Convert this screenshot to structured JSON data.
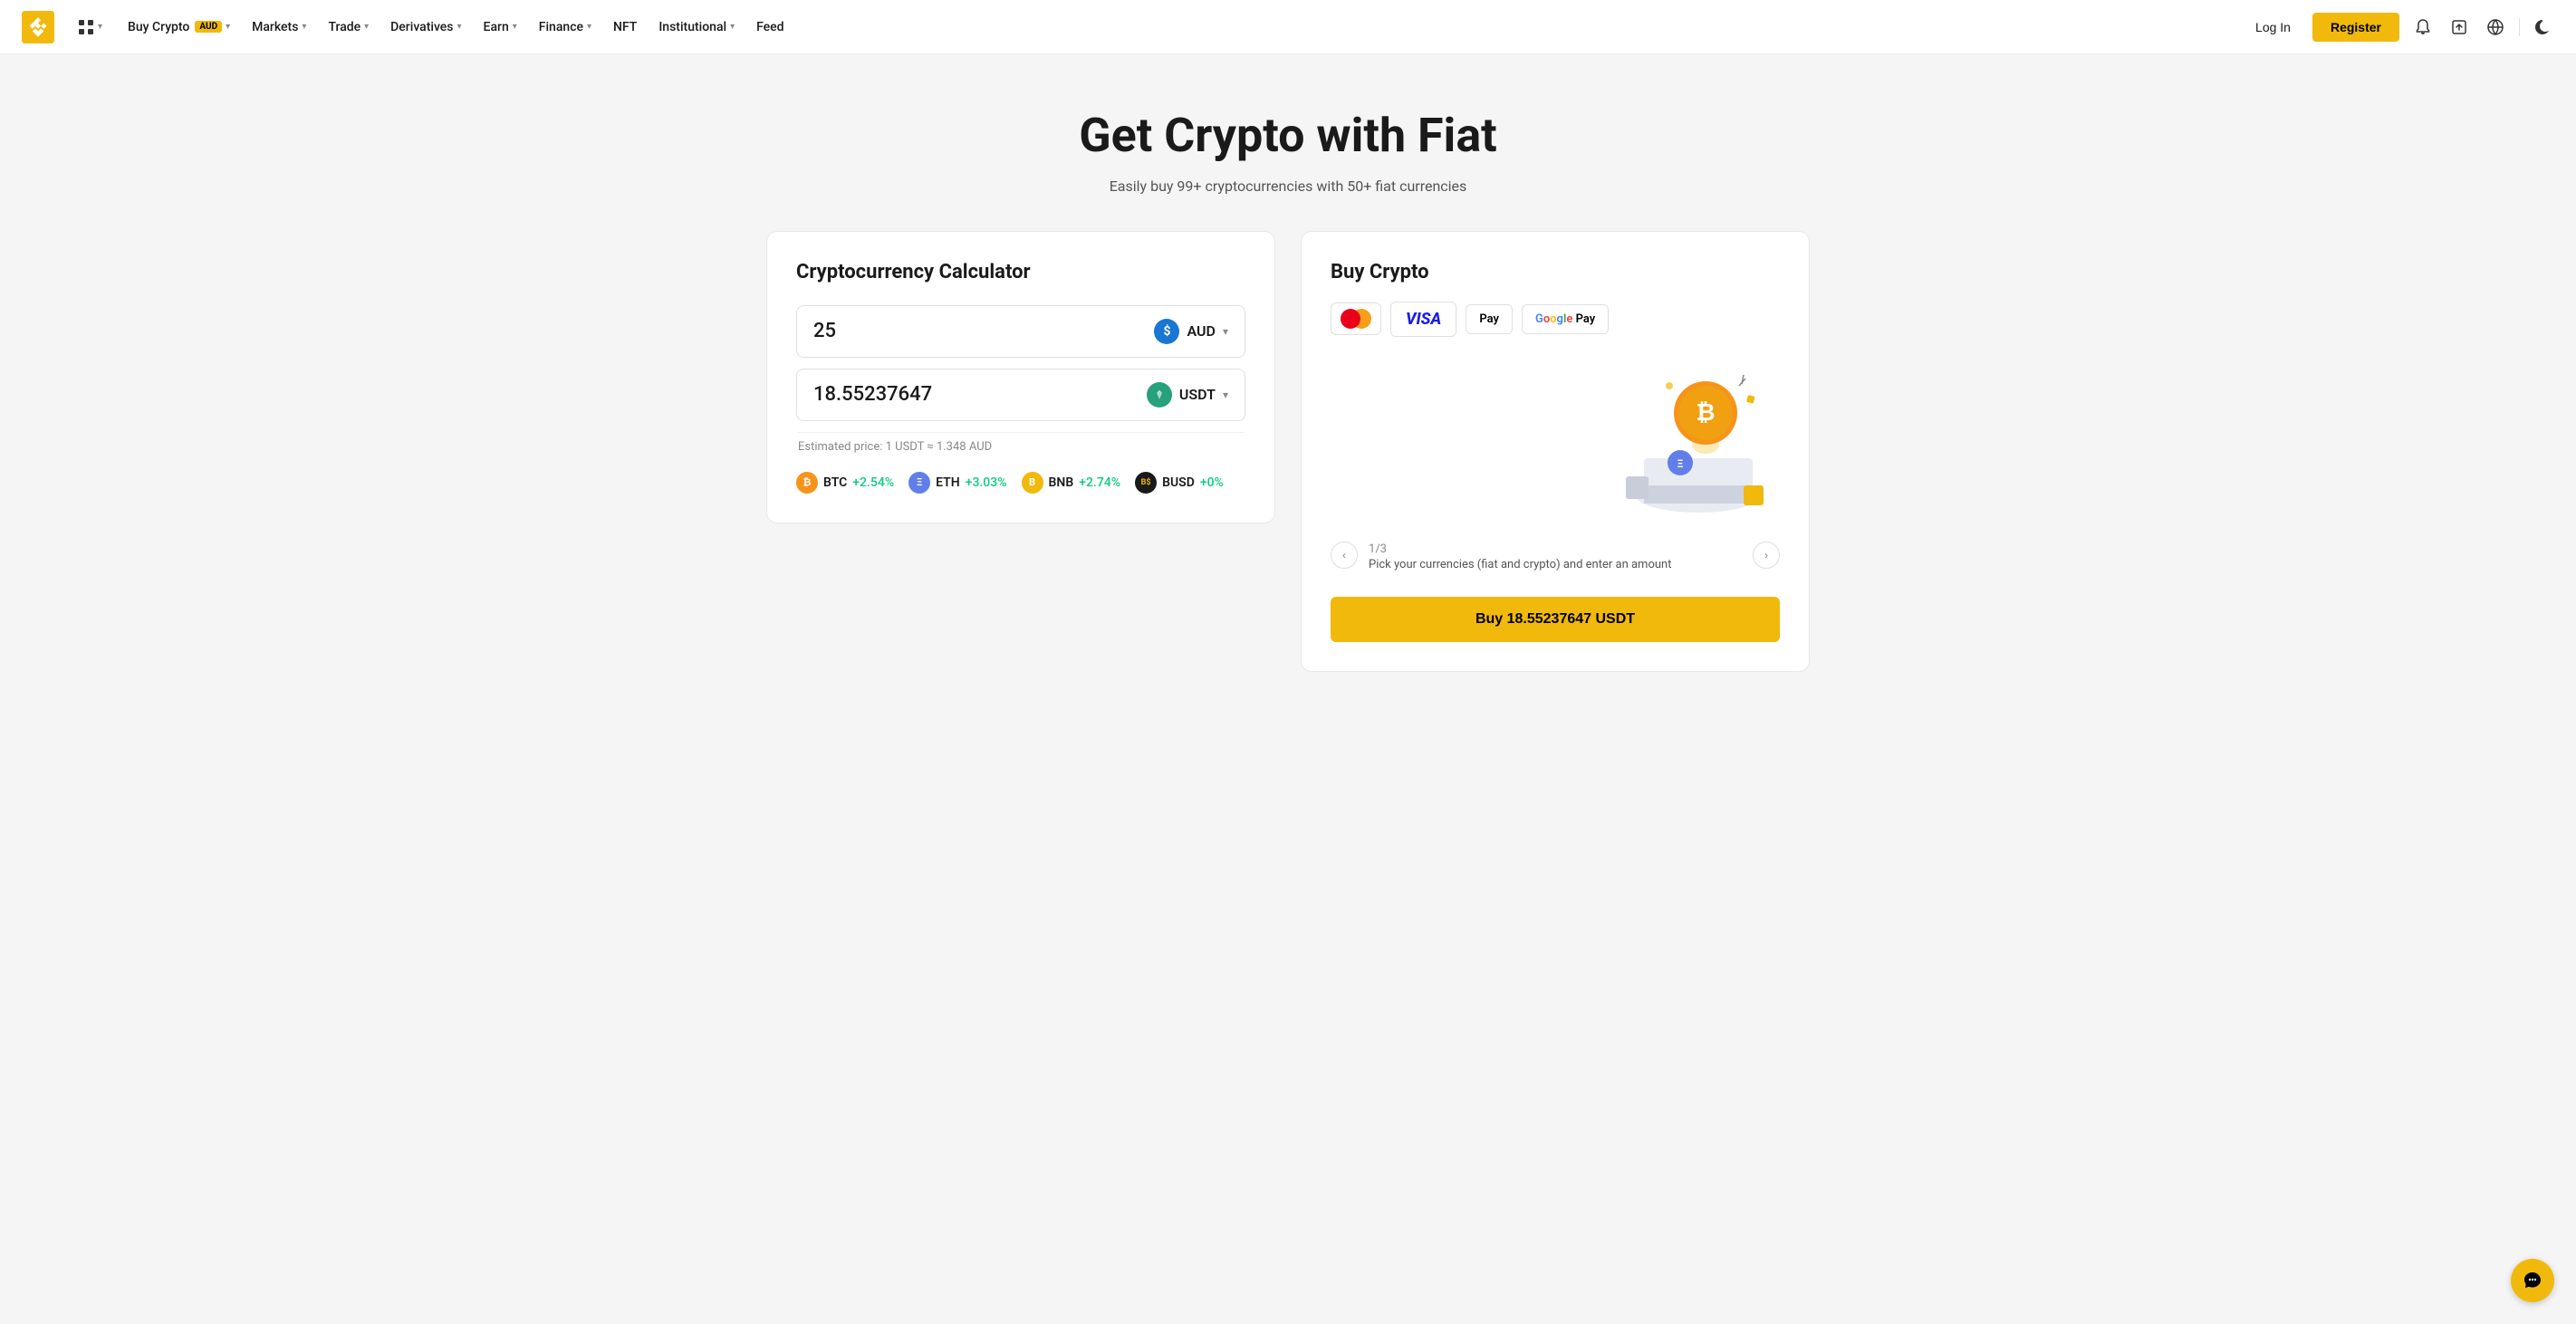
{
  "brand": {
    "name": "Binance",
    "logo_alt": "Binance Logo"
  },
  "navbar": {
    "buy_crypto_label": "Buy Crypto",
    "buy_crypto_badge": "AUD",
    "markets_label": "Markets",
    "trade_label": "Trade",
    "derivatives_label": "Derivatives",
    "earn_label": "Earn",
    "finance_label": "Finance",
    "nft_label": "NFT",
    "institutional_label": "Institutional",
    "feed_label": "Feed",
    "login_label": "Log In",
    "register_label": "Register"
  },
  "hero": {
    "title": "Get Crypto with Fiat",
    "subtitle": "Easily buy 99+ cryptocurrencies with 50+ fiat currencies"
  },
  "calculator": {
    "title": "Cryptocurrency Calculator",
    "fiat_value": "25",
    "fiat_currency": "AUD",
    "crypto_value": "18.55237647",
    "crypto_currency": "USDT",
    "estimated_price": "Estimated price: 1 USDT ≈ 1.348 AUD",
    "coins": [
      {
        "id": "btc",
        "name": "BTC",
        "change": "+2.54%"
      },
      {
        "id": "eth",
        "name": "ETH",
        "change": "+3.03%"
      },
      {
        "id": "bnb",
        "name": "BNB",
        "change": "+2.74%"
      },
      {
        "id": "busd",
        "name": "BUSD",
        "change": "+0%"
      }
    ]
  },
  "buy_crypto": {
    "title": "Buy Crypto",
    "payment_methods": [
      "mastercard",
      "visa",
      "apple_pay",
      "google_pay"
    ],
    "step_current": "1",
    "step_total": "/3",
    "step_description": "Pick your currencies (fiat and crypto) and enter an amount",
    "buy_button_label": "Buy 18.55237647 USDT"
  },
  "icons": {
    "chat": "💬",
    "bell": "🔔",
    "upload": "⬆",
    "globe": "🌐",
    "moon": "🌙",
    "grid": "⊞",
    "chevron_down": "▾",
    "chevron_left": "‹",
    "chevron_right": "›"
  }
}
